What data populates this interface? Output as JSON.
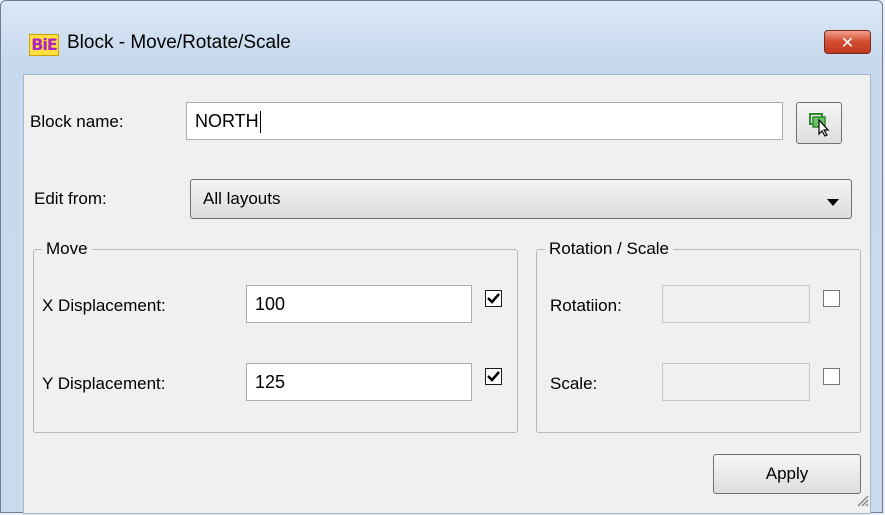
{
  "window": {
    "app_icon_text": "BiE",
    "title": "Block - Move/Rotate/Scale",
    "close_glyph": "✕"
  },
  "block_name": {
    "label": "Block name:",
    "value": "NORTH",
    "pick_button_icon": "pick-block-cursor-icon"
  },
  "edit_from": {
    "label": "Edit from:",
    "selected": "All layouts"
  },
  "move": {
    "legend": "Move",
    "x_label": "X Displacement:",
    "x_value": "100",
    "x_checked": true,
    "y_label": "Y Displacement:",
    "y_value": "125",
    "y_checked": true
  },
  "rotation_scale": {
    "legend": "Rotation / Scale",
    "rotation_label": "Rotatiion:",
    "rotation_value": "",
    "rotation_checked": false,
    "scale_label": "Scale:",
    "scale_value": "",
    "scale_checked": false
  },
  "apply_label": "Apply",
  "colors": {
    "title_gradient_top": "#dce8f5",
    "close_button": "#d24a30",
    "dialog_bg": "#f0f0f0"
  }
}
